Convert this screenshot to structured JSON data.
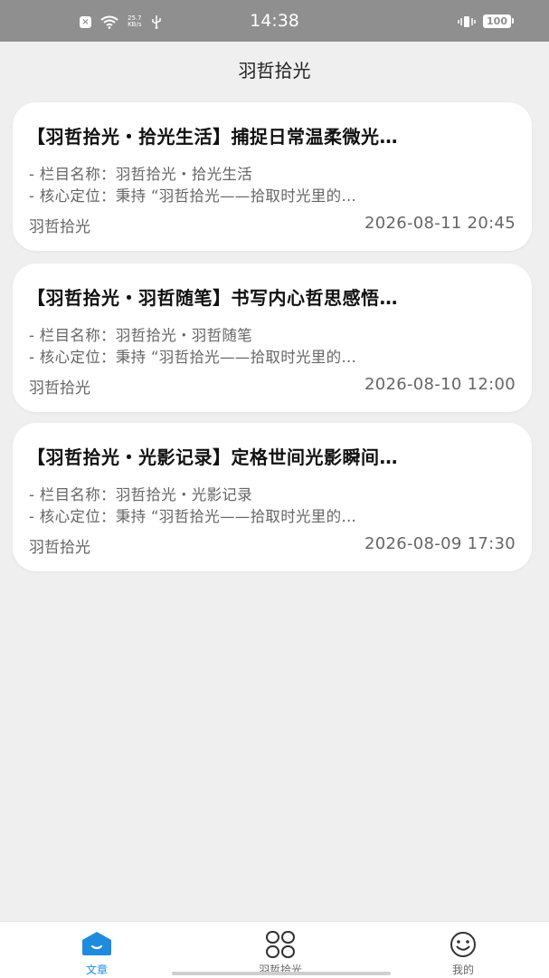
{
  "status_bar": {
    "time": "14:38",
    "netspeed_value": "25.7",
    "netspeed_unit": "KB/s",
    "battery": "100"
  },
  "nav": {
    "title": "羽哲拾光"
  },
  "articles": [
    {
      "title": "【羽哲拾光・拾光生活】捕捉日常温柔微光…",
      "line1": "- 栏目名称：羽哲拾光・拾光生活",
      "line2": "- 核心定位：秉持 “羽哲拾光——拾取时光里的…",
      "author": "羽哲拾光",
      "date": "2026-08-11 20:45"
    },
    {
      "title": "【羽哲拾光・羽哲随笔】书写内心哲思感悟…",
      "line1": "- 栏目名称：羽哲拾光・羽哲随笔",
      "line2": "- 核心定位：秉持 “羽哲拾光——拾取时光里的…",
      "author": "羽哲拾光",
      "date": "2026-08-10 12:00"
    },
    {
      "title": "【羽哲拾光・光影记录】定格世间光影瞬间…",
      "line1": "- 栏目名称：羽哲拾光・光影记录",
      "line2": "- 核心定位：秉持 “羽哲拾光——拾取时光里的…",
      "author": "羽哲拾光",
      "date": "2026-08-09 17:30"
    }
  ],
  "tabs": [
    {
      "label": "文章",
      "icon": "home-icon",
      "active": true
    },
    {
      "label": "羽哲拾光",
      "icon": "grid-clover-icon",
      "active": false
    },
    {
      "label": "我的",
      "icon": "smiley-icon",
      "active": false
    }
  ],
  "colors": {
    "accent": "#1e8bdc",
    "status_bar": "#8f8f8f",
    "background": "#efefef"
  }
}
